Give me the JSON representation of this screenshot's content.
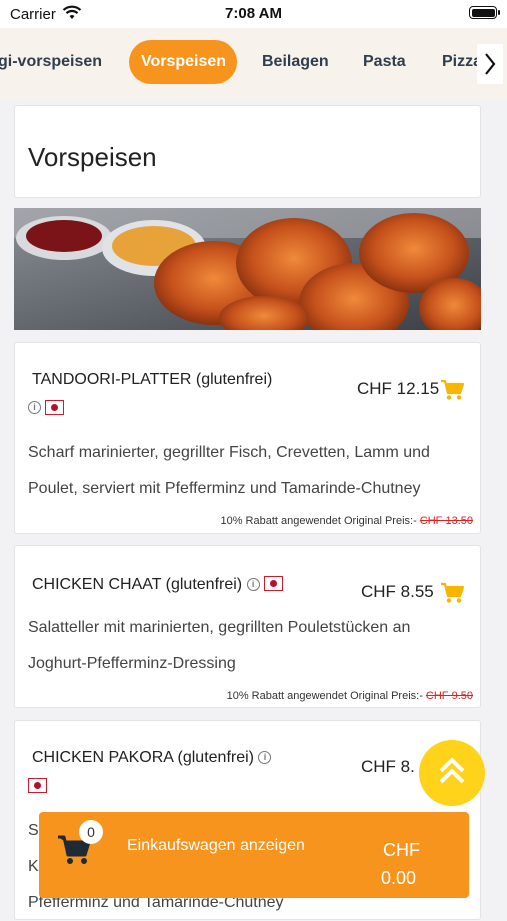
{
  "status_bar": {
    "carrier": "Carrier",
    "time": "7:08 AM"
  },
  "tabs": [
    {
      "label": "gi-vorspeisen"
    },
    {
      "label": "Vorspeisen",
      "active": true
    },
    {
      "label": "Beilagen"
    },
    {
      "label": "Pasta"
    },
    {
      "label": "Pizza"
    }
  ],
  "section": {
    "title": "Vorspeisen"
  },
  "items": [
    {
      "name": "TANDOORI-PLATTER (glutenfrei)",
      "price": "CHF 12.15",
      "description": "Scharf marinierter, gegrillter Fisch, Crevetten, Lamm und Poulet, serviert mit Pfefferminz und Tamarinde-Chutney",
      "discount_label": "10% Rabatt angewendet Original Preis:-",
      "original_price": "CHF 13.50"
    },
    {
      "name": "CHICKEN CHAAT (glutenfrei)",
      "price": "CHF 8.55",
      "description": "Salatteller mit marinierten, gegrillten Pouletstücken an Joghurt-Pfefferminz-Dressing",
      "discount_label": "10% Rabatt angewendet Original Preis:-",
      "original_price": "CHF 9.50"
    },
    {
      "name": "CHICKEN PAKORA (glutenfrei)",
      "price": "CHF 8.",
      "description_partial_1": "S",
      "description_partial_2": "K",
      "description_partial_3": "Pfefferminz und Tamarinde-Chutney"
    }
  ],
  "cart_bar": {
    "count": "0",
    "label": "Einkaufswagen anzeigen",
    "currency": "CHF",
    "amount": "0.00"
  },
  "colors": {
    "accent": "#f7941d",
    "fab": "#ffd31a",
    "strike": "#e02020"
  },
  "icons": [
    "wifi-icon",
    "battery-icon",
    "chevron-right-icon",
    "cart-icon",
    "info-icon",
    "flag-icon",
    "scroll-top-icon"
  ]
}
